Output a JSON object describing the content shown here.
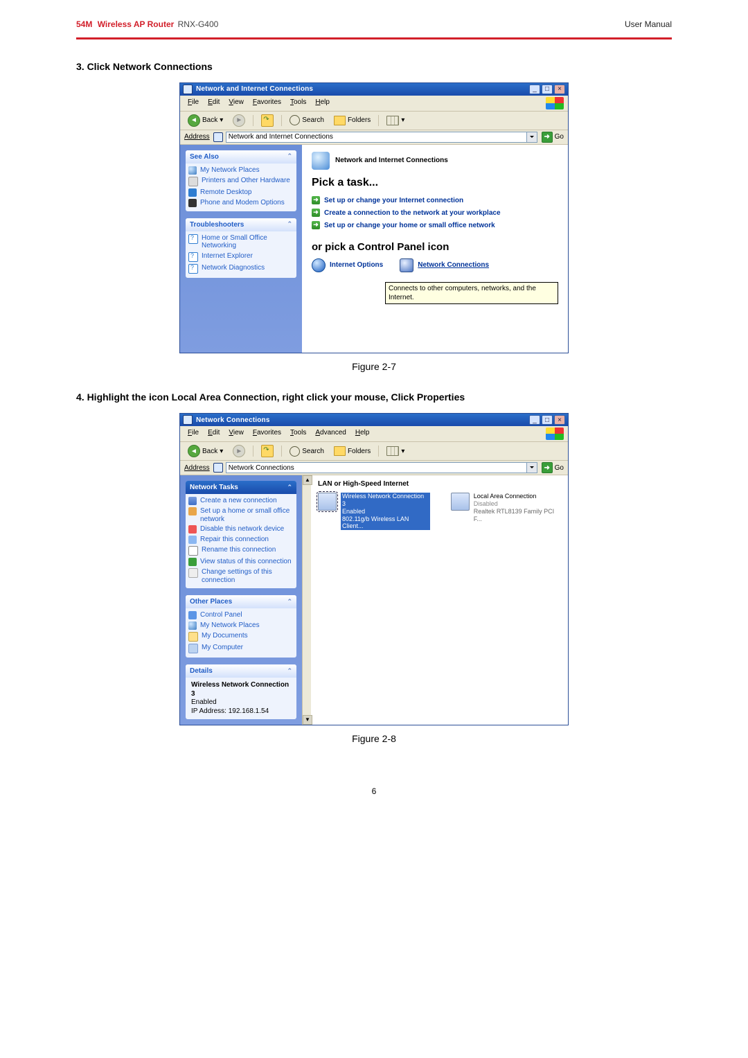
{
  "header": {
    "productA": "54M",
    "productB": "Wireless AP Router",
    "model": "RNX-G400",
    "right": "User Manual"
  },
  "steps": {
    "s3": "3. Click Network Connections",
    "s4": "4. Highlight the icon Local Area Connection, right click your mouse, Click Properties"
  },
  "fig27": "Figure 2-7",
  "fig28": "Figure 2-8",
  "pagenum": "6",
  "win1": {
    "title": "Network and Internet Connections",
    "menus": [
      "File",
      "Edit",
      "View",
      "Favorites",
      "Tools",
      "Help"
    ],
    "toolbar": {
      "back": "Back",
      "search": "Search",
      "folders": "Folders"
    },
    "address": {
      "label": "Address",
      "value": "Network and Internet Connections",
      "go": "Go"
    },
    "side": {
      "seeAlso": {
        "title": "See Also",
        "items": [
          "My Network Places",
          "Printers and Other Hardware",
          "Remote Desktop",
          "Phone and Modem Options"
        ]
      },
      "troubleshooters": {
        "title": "Troubleshooters",
        "items": [
          "Home or Small Office Networking",
          "Internet Explorer",
          "Network Diagnostics"
        ]
      }
    },
    "main": {
      "catTitle": "Network and Internet Connections",
      "pick": "Pick a task...",
      "tasks": [
        "Set up or change your Internet connection",
        "Create a connection to the network at your workplace",
        "Set up or change your home or small office network"
      ],
      "orpick": "or pick a Control Panel icon",
      "cp": {
        "io": "Internet Options",
        "nc": "Network Connections"
      },
      "tooltip": "Connects to other computers, networks, and the Internet."
    }
  },
  "win2": {
    "title": "Network Connections",
    "menus": [
      "File",
      "Edit",
      "View",
      "Favorites",
      "Tools",
      "Advanced",
      "Help"
    ],
    "toolbar": {
      "back": "Back",
      "search": "Search",
      "folders": "Folders"
    },
    "address": {
      "label": "Address",
      "value": "Network Connections",
      "go": "Go"
    },
    "side": {
      "tasks": {
        "title": "Network Tasks",
        "items": [
          "Create a new connection",
          "Set up a home or small office network",
          "Disable this network device",
          "Repair this connection",
          "Rename this connection",
          "View status of this connection",
          "Change settings of this connection"
        ]
      },
      "other": {
        "title": "Other Places",
        "items": [
          "Control Panel",
          "My Network Places",
          "My Documents",
          "My Computer"
        ]
      },
      "details": {
        "title": "Details",
        "name": "Wireless Network Connection 3",
        "status": "Enabled",
        "ip": "IP Address: 192.168.1.54"
      }
    },
    "main": {
      "group": "LAN or High-Speed Internet",
      "connA": {
        "name": "Wireless Network Connection 3",
        "status": "Enabled",
        "dev": "802.11g/b Wireless LAN Client..."
      },
      "connB": {
        "name": "Local Area Connection",
        "status": "Disabled",
        "dev": "Realtek RTL8139 Family PCI F..."
      }
    }
  }
}
